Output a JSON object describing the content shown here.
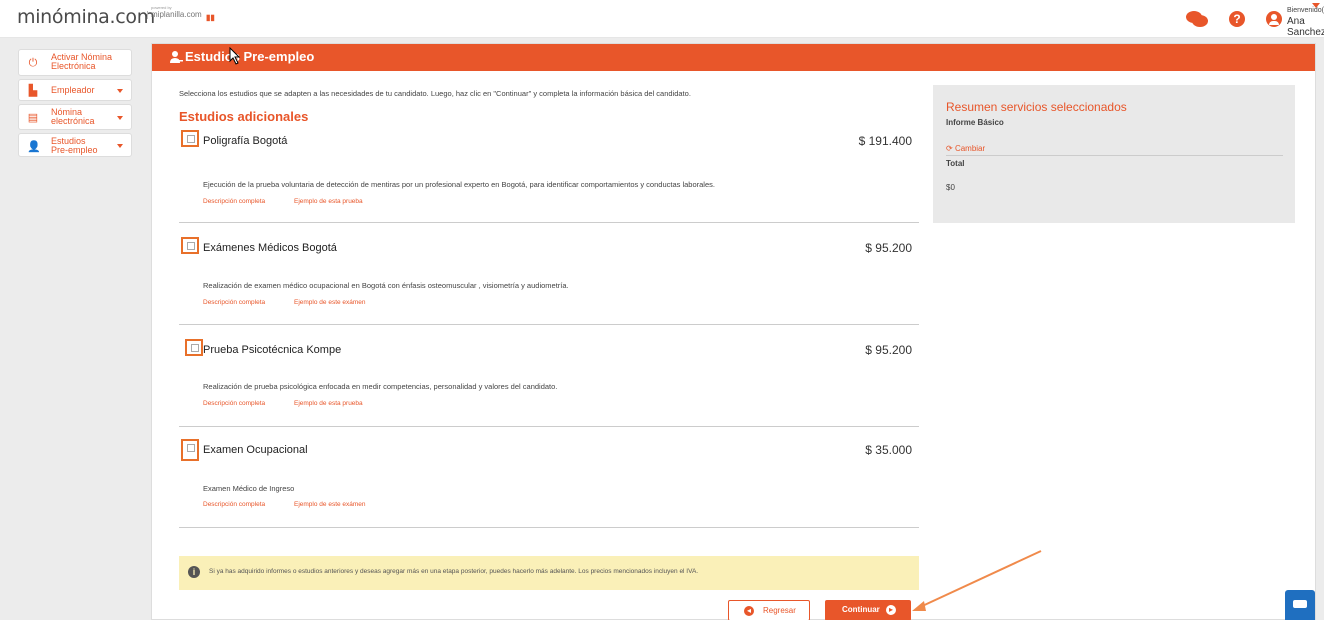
{
  "header": {
    "logo": "minómina.com",
    "sublogo_small": "powered by",
    "sublogo": "miplanilla.com",
    "flag": "▮▮",
    "welcome": "Bienvenido(A)",
    "username": "Ana Sanchez",
    "help_glyph": "?"
  },
  "sidebar": {
    "items": [
      {
        "label": "Activar Nómina Electrónica",
        "icon": "power-icon"
      },
      {
        "label": "Empleador",
        "icon": "building-icon"
      },
      {
        "label": "Nómina electrónica",
        "icon": "document-icon"
      },
      {
        "label": "Estudios Pre-empleo",
        "icon": "user-plus-icon"
      }
    ]
  },
  "main": {
    "title": "Estudios Pre-empleo",
    "intro": "Selecciona los estudios que se adapten a las necesidades de tu candidato. Luego, haz clic en \"Continuar\" y completa la información básica del candidato.",
    "section_title": "Estudios adicionales",
    "studies": [
      {
        "name": "Poligrafía Bogotá",
        "price": "$ 191.400",
        "description": "Ejecución de la prueba voluntaria de detección de mentiras por un profesional experto en Bogotá, para identificar comportamientos y conductas laborales.",
        "link1": "Descripción completa",
        "link2": "Ejemplo de esta prueba"
      },
      {
        "name": "Exámenes Médicos Bogotá",
        "price": "$ 95.200",
        "description": "Realización de examen médico ocupacional en Bogotá con énfasis osteomuscular , visiometría y audiometría.",
        "link1": "Descripción completa",
        "link2": "Ejemplo de este exámen"
      },
      {
        "name": "Prueba Psicotécnica Kompe",
        "price": "$ 95.200",
        "description": "Realización de prueba psicológica enfocada en medir competencias, personalidad y valores del candidato.",
        "link1": "Descripción completa",
        "link2": "Ejemplo de esta prueba"
      },
      {
        "name": "Examen Ocupacional",
        "price": "$ 35.000",
        "description": "Examen Médico de Ingreso",
        "link1": "Descripción completa",
        "link2": "Ejemplo de este exámen"
      }
    ],
    "notice": "Si ya has adquirido informes o estudios anteriores y deseas agregar más en una etapa posterior, puedes hacerlo más adelante. Los precios mencionados incluyen el IVA.",
    "back_label": "Regresar",
    "continue_label": "Continuar"
  },
  "summary": {
    "title": "Resumen servicios seleccionados",
    "subtitle": "Informe Básico",
    "change_label": "Cambiar",
    "total_label": "Total",
    "total_value": "$0"
  },
  "colors": {
    "accent": "#e8562a",
    "notice_bg": "#faf0b8",
    "chat_widget": "#1f6fc0"
  }
}
